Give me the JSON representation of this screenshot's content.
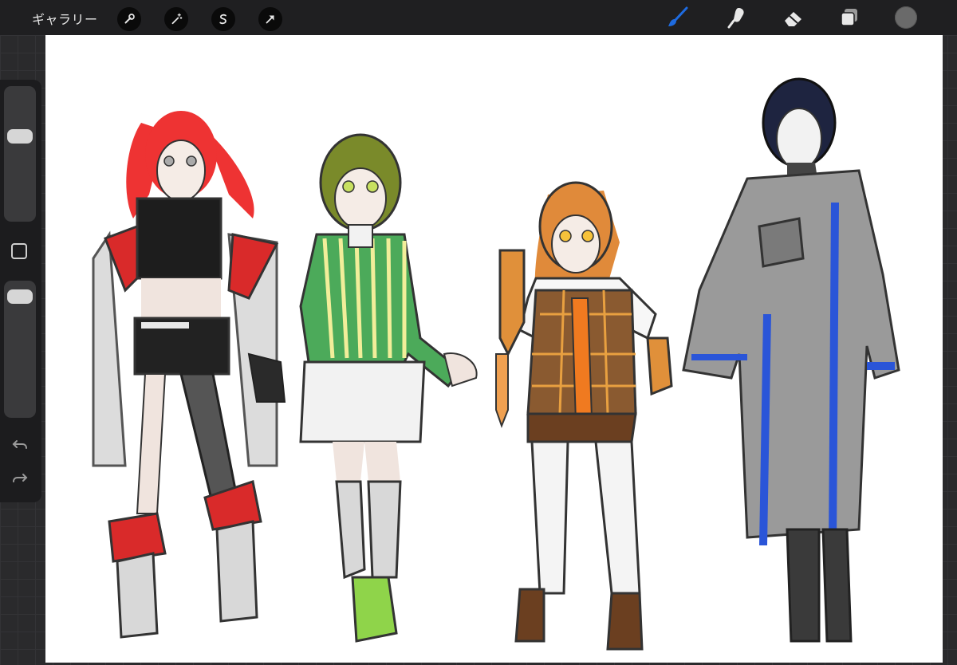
{
  "toolbar": {
    "gallery_label": "ギャラリー",
    "left_tools": [
      "wrench-icon",
      "magic-wand-icon",
      "selection-s-icon",
      "transform-arrow-icon"
    ],
    "right_tools": [
      "brush-icon",
      "smudge-icon",
      "eraser-icon",
      "layers-icon"
    ],
    "active_tool": "brush-icon",
    "active_color": "#1e6be0",
    "current_color": "#6a6a6a"
  },
  "sidebar": {
    "brush_size_fraction": 0.65,
    "opacity_fraction": 0.95
  },
  "artwork": {
    "characters": [
      {
        "hair": "#ee3333",
        "top": "#1d1d1d",
        "coat": "#dcdcdc",
        "accent": "#d92a2a"
      },
      {
        "hair": "#7a8a2a",
        "top": "#4caa5a",
        "skirt": "#f2f2f2",
        "accent": "#8fd44a"
      },
      {
        "hair": "#e08a3a",
        "top": "#8a5a30",
        "shorts": "#6b3f20",
        "accent": "#f07a20"
      },
      {
        "hair": "#1e2440",
        "coat": "#9a9a9a",
        "accent": "#2a55d8"
      }
    ]
  }
}
